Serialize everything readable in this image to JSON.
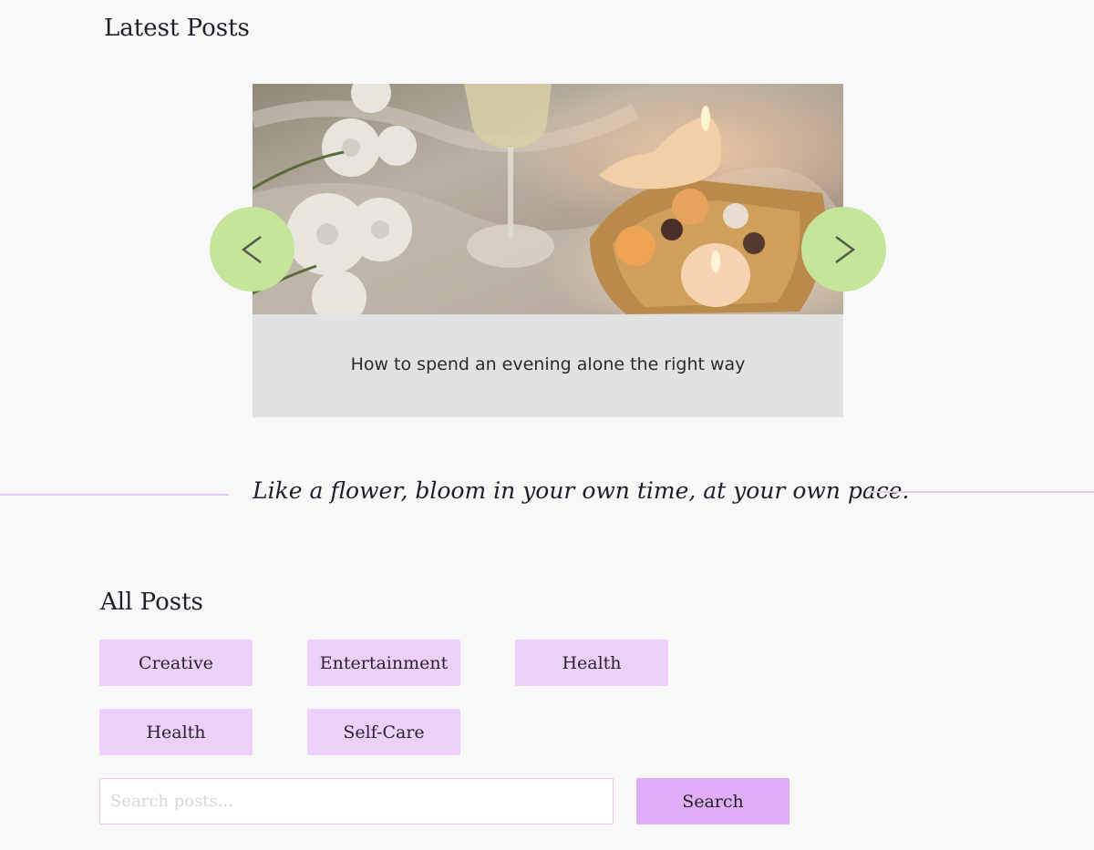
{
  "latest": {
    "title": "Latest Posts",
    "slide": {
      "caption": "How to spend an evening alone the right way"
    },
    "prev_icon": "chevron-left-icon",
    "next_icon": "chevron-right-icon"
  },
  "quote": {
    "text": "Like a flower, bloom in your own time, at your own pace."
  },
  "all_posts": {
    "title": "All Posts",
    "categories": [
      "Creative",
      "Entertainment",
      "Health",
      "Health",
      "Self-Care"
    ]
  },
  "search": {
    "placeholder": "Search posts...",
    "value": "",
    "button_label": "Search"
  },
  "colors": {
    "background": "#f8f8f8",
    "nav_button": "#c5e59a",
    "category_button": "#edd1fb",
    "search_button": "#e0aef9",
    "divider": "#e2c9f2",
    "caption_box": "#e2e2e2"
  }
}
